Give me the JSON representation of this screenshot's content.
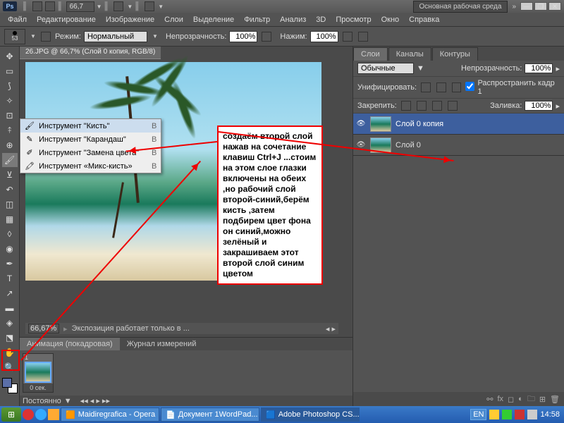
{
  "titlebar": {
    "ps": "Ps",
    "zoom_label": "66,7",
    "workspace": "Основная рабочая среда"
  },
  "menubar": [
    "Файл",
    "Редактирование",
    "Изображение",
    "Слои",
    "Выделение",
    "Фильтр",
    "Анализ",
    "3D",
    "Просмотр",
    "Окно",
    "Справка"
  ],
  "optbar": {
    "brush_size": "53",
    "mode_label": "Режим:",
    "mode_value": "Нормальный",
    "opacity_label": "Непрозрачность:",
    "opacity_value": "100%",
    "flow_label": "Нажим:",
    "flow_value": "100%"
  },
  "doc_tab": "26.JPG @ 66,7% (Слой 0 копия, RGB/8)",
  "canvas_status": {
    "zoom": "66,67%",
    "info": "Экспозиция работает только в ..."
  },
  "brush_popup": [
    {
      "icon": "🖌",
      "label": "Инструмент \"Кисть\"",
      "key": "B",
      "sel": true
    },
    {
      "icon": "✎",
      "label": "Инструмент \"Карандаш\"",
      "key": "B",
      "sel": false
    },
    {
      "icon": "✐",
      "label": "Инструмент \"Замена цвета\"",
      "key": "B",
      "sel": false
    },
    {
      "icon": "🖍",
      "label": "Инструмент «Микс-кисть»",
      "key": "B",
      "sel": false
    }
  ],
  "annotation": "создаём  второй слой нажав на сочетание клавиш Ctrl+J    ...стоим на этом слое глазки включены на обеих ,но рабочий слой второй-синий,берём кисть ,затем подбирем цвет фона он синий,можно зелёный и закрашиваем этот второй слой синим цветом",
  "anim": {
    "tab1": "Анимация (покадровая)",
    "tab2": "Журнал измерений",
    "frame_num": "1",
    "frame_dur": "0 сек.",
    "loop": "Постоянно"
  },
  "layers_panel": {
    "tabs": [
      "Слои",
      "Каналы",
      "Контуры"
    ],
    "blend": "Обычные",
    "opacity_label": "Непрозрачность:",
    "opacity": "100%",
    "unify_label": "Унифицировать:",
    "propagate": "Распространить кадр 1",
    "lock_label": "Закрепить:",
    "fill_label": "Заливка:",
    "fill": "100%",
    "layers": [
      {
        "name": "Слой 0 копия",
        "sel": true
      },
      {
        "name": "Слой 0",
        "sel": false
      }
    ]
  },
  "taskbar": {
    "tasks": [
      {
        "icon": "🟧",
        "label": "Maidiregrafica - Opera"
      },
      {
        "icon": "📄",
        "label": "Документ 1WordPad..."
      },
      {
        "icon": "🟦",
        "label": "Adobe Photoshop CS...",
        "active": true
      }
    ],
    "lang": "EN",
    "time": "14:58"
  }
}
